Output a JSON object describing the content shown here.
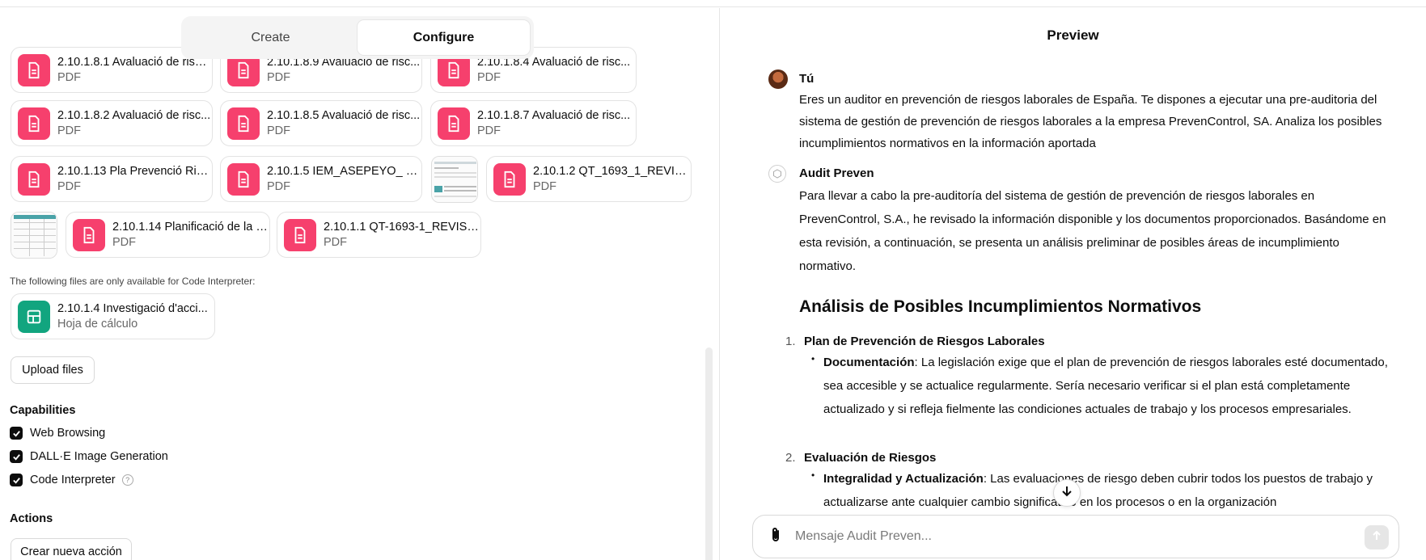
{
  "tabs": {
    "create": "Create",
    "configure": "Configure"
  },
  "files": [
    {
      "name": "2.10.1.8.1 Avaluació de risco...",
      "type": "PDF"
    },
    {
      "name": "2.10.1.8.9 Avaluació de risc...",
      "type": "PDF"
    },
    {
      "name": "2.10.1.8.4 Avaluació de risc...",
      "type": "PDF"
    },
    {
      "name": "2.10.1.8.2 Avaluació de risc...",
      "type": "PDF"
    },
    {
      "name": "2.10.1.8.5 Avaluació de risc...",
      "type": "PDF"
    },
    {
      "name": "2.10.1.8.7 Avaluació de risc...",
      "type": "PDF"
    },
    {
      "name": "2.10.1.13 Pla Prevenció Risc...",
      "type": "PDF"
    },
    {
      "name": "2.10.1.5 IEM_ASEPEYO_ 20...",
      "type": "PDF"
    },
    {
      "name": "2.10.1.2 QT_1693_1_REVISI...",
      "type": "PDF"
    },
    {
      "name": "2.10.1.14 Planificació de la p...",
      "type": "PDF"
    },
    {
      "name": "2.10.1.1 QT-1693-1_REVISIO...",
      "type": "PDF"
    }
  ],
  "code_interpreter_note": "The following files are only available for Code Interpreter:",
  "ci_file": {
    "name": "2.10.1.4 Investigació d'acci...",
    "type": "Hoja de cálculo"
  },
  "upload_label": "Upload files",
  "capabilities": {
    "title": "Capabilities",
    "items": [
      "Web Browsing",
      "DALL·E Image Generation",
      "Code Interpreter"
    ],
    "help": "?"
  },
  "actions": {
    "title": "Actions",
    "button": "Crear nueva acción"
  },
  "preview": {
    "title": "Preview",
    "user_name": "Tú",
    "user_message": "Eres un auditor en prevención de riesgos laborales de España. Te dispones a ejecutar una pre-auditoria del sistema de gestión de prevención de riesgos laborales a la empresa PrevenControl, SA. Analiza los posibles incumplimientos normativos en la información aportada",
    "bot_name": "Audit Preven",
    "bot_intro": "Para llevar a cabo la pre-auditoría del sistema de gestión de prevención de riesgos laborales en PrevenControl, S.A., he revisado la información disponible y los documentos proporcionados. Basándome en esta revisión, a continuación, se presenta un análisis preliminar de posibles áreas de incumplimiento normativo.",
    "heading": "Análisis de Posibles Incumplimientos Normativos",
    "items": [
      {
        "num": "1.",
        "title": "Plan de Prevención de Riesgos Laborales",
        "bullet_title": "Documentación",
        "bullet_text": ": La legislación exige que el plan de prevención de riesgos laborales esté documentado, sea accesible y se actualice regularmente. Sería necesario verificar si el plan está completamente actualizado y si refleja fielmente las condiciones actuales de trabajo y los procesos empresariales."
      },
      {
        "num": "2.",
        "title": "Evaluación de Riesgos",
        "bullet_title": "Integralidad y Actualización",
        "bullet_text": ": Las evaluaciones de riesgo deben cubrir todos los puestos de trabajo y actualizarse ante cualquier cambio significativo en los procesos o en la organización"
      }
    ],
    "composer_placeholder": "Mensaje Audit Preven..."
  },
  "colors": {
    "pdf": "#f6406d",
    "sheet": "#12a57f"
  },
  "icons": [
    "document-icon",
    "spreadsheet-icon",
    "checkbox-icon",
    "paperclip-icon",
    "arrow-up-icon",
    "arrow-down-icon",
    "bot-avatar-icon"
  ]
}
